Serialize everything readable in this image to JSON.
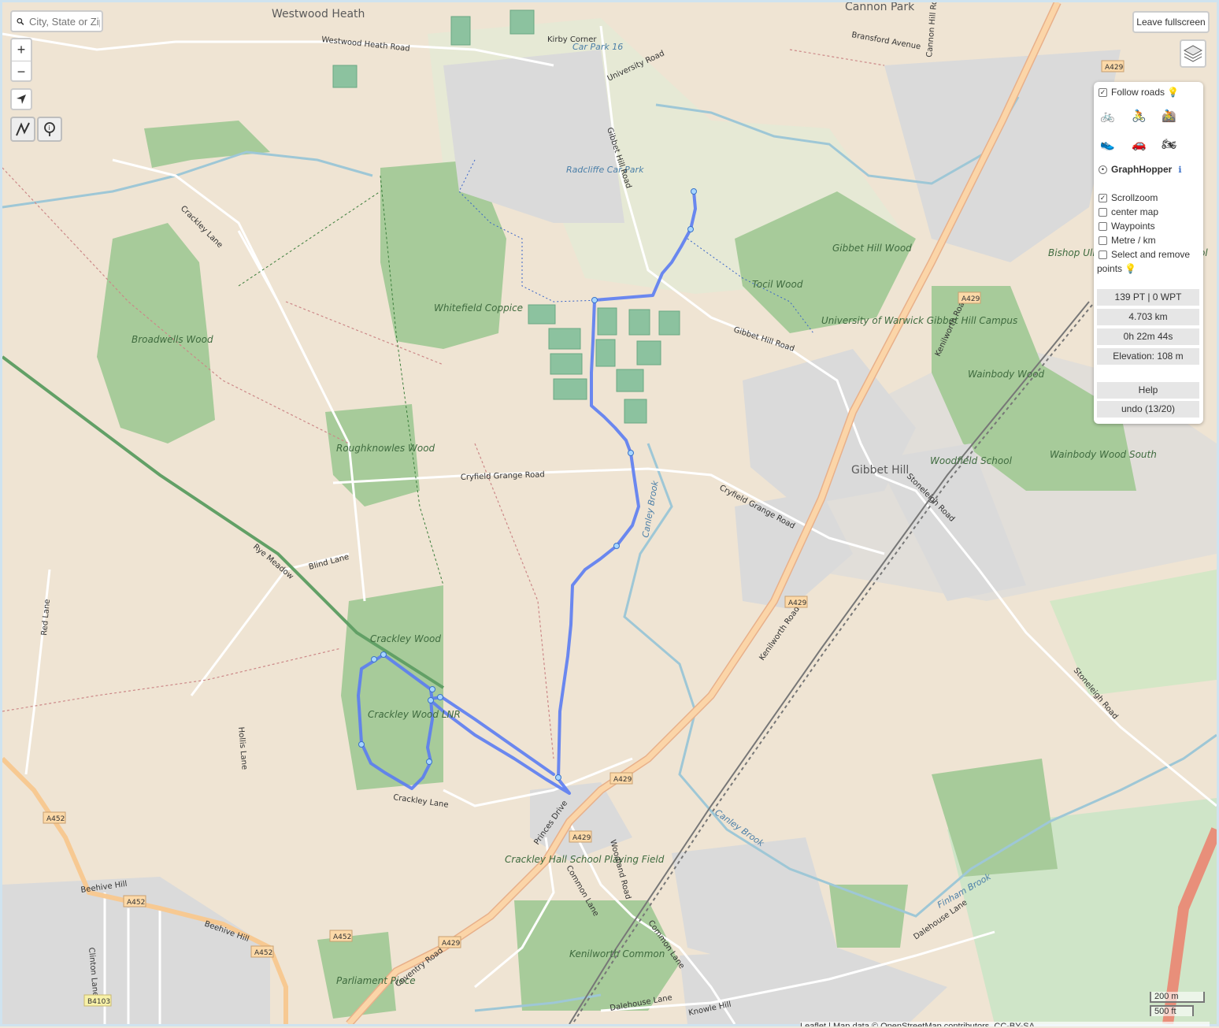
{
  "search": {
    "placeholder": "City, State or Zip"
  },
  "zoom": {
    "in_label": "+",
    "out_label": "−"
  },
  "fullscreen_label": "Leave fullscreen",
  "panel": {
    "follow_roads": {
      "label": "Follow roads",
      "checked": true
    },
    "router": "GraphHopper",
    "options": [
      {
        "label": "Scrollzoom",
        "checked": true
      },
      {
        "label": "center map",
        "checked": false
      },
      {
        "label": "Waypoints",
        "checked": false
      },
      {
        "label": "Metre / km",
        "checked": false
      },
      {
        "label": "Select and remove",
        "checked": false
      }
    ],
    "options_tail": "points",
    "stats": {
      "points": "139 PT | 0 WPT",
      "distance": "4.703 km",
      "time": "0h 22m 44s",
      "elevation": "Elevation: 108 m"
    },
    "help_label": "Help",
    "undo_label": "undo (13/20)"
  },
  "scale": {
    "metric": "200 m",
    "imperial": "500 ft"
  },
  "attribution": "Leaflet | Map data © OpenStreetMap contributors, CC-BY-SA",
  "map_labels": {
    "westwood_heath": "Westwood Heath",
    "westwood_heath_road": "Westwood Heath Road",
    "cannon_park": "Cannon Park",
    "kirby_corner": "Kirby Corner",
    "car_park_16": "Car Park 16",
    "radcliffe": "Radcliffe Car Park",
    "university_road": "University Road",
    "gibbet_hill_road": "Gibbet Hill Road",
    "whitefield_coppice": "Whitefield Coppice",
    "broadwells_wood": "Broadwells Wood",
    "roughknowles_wood": "Roughknowles Wood",
    "crackley_lane": "Crackley Lane",
    "cryfield_grange_road": "Cryfield Grange Road",
    "blind_lane": "Blind Lane",
    "rye_meadow": "Rye Meadow",
    "red_lane": "Red Lane",
    "crackley_wood": "Crackley Wood",
    "crackley_wood_lnr": "Crackley Wood LNR",
    "canley_brook": "Canley Brook",
    "tocil_wood": "Tocil Wood",
    "gibbet_hill_wood": "Gibbet Hill Wood",
    "uow_gibbet": "University of Warwick Gibbet Hill Campus",
    "bishop": "Bishop Ullathorne Catholic School",
    "wainbody_wood": "Wainbody Wood",
    "wainbody_wood_south": "Wainbody Wood South",
    "gibbet_hill": "Gibbet Hill",
    "woodfield_school": "Woodfield School",
    "kenilworth_road": "Kenilworth Road",
    "a429": "A429",
    "a452": "A452",
    "b4103": "B4103",
    "stoneleigh_road": "Stoneleigh Road",
    "beehive_hill": "Beehive Hill",
    "crackley_hall": "Crackley Hall School Playing Field",
    "parliament_piece": "Parliament Piece",
    "kenilworth_common": "Kenilworth Common",
    "common_lane": "Common Lane",
    "coventry_road": "Coventry Road",
    "finham_brook": "Finham Brook",
    "dalehouse_lane": "Dalehouse Lane",
    "knowle_hill": "Knowle Hill",
    "clinton_lane": "Clinton Lane",
    "hollis_lane": "Hollis Lane",
    "princes_drive": "Princes Drive",
    "woodland_road": "Woodland Road",
    "cannon_hill_road": "Cannon Hill Road",
    "bransford_avenue": "Bransford Avenue"
  },
  "colors": {
    "route": "#5b7cf2",
    "wood": "#a7cb9a",
    "farmland": "#f1e2cf",
    "primary": "#fbd9a5",
    "trunk": "#f3b891"
  }
}
